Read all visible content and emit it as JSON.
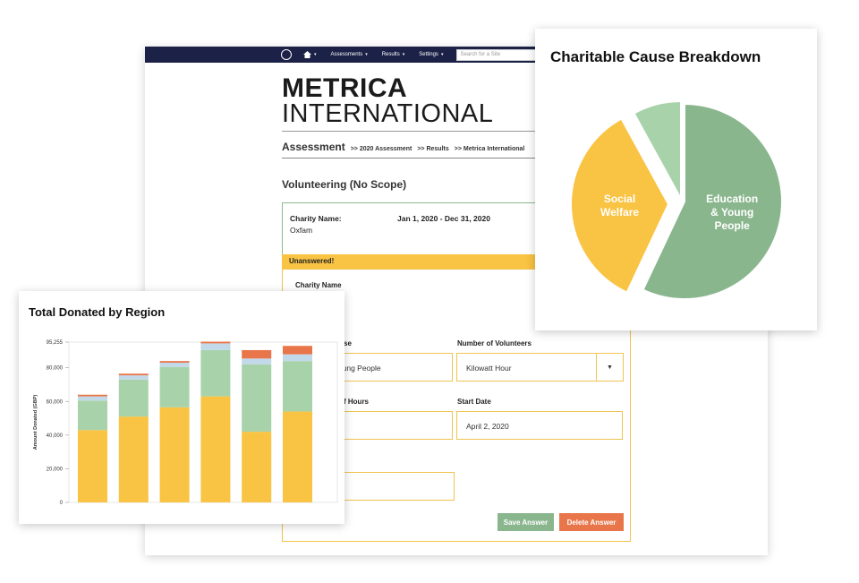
{
  "navbar": {
    "home_icon": "home-icon",
    "items": [
      {
        "label": "Assessments"
      },
      {
        "label": "Results"
      },
      {
        "label": "Settings"
      }
    ],
    "search_placeholder": "Search for a Site"
  },
  "brand": {
    "title": "METRICA",
    "subtitle": "INTERNATIONAL"
  },
  "breadcrumb": {
    "title": "Assessment",
    "items": [
      ">> 2020 Assessment",
      ">> Results",
      ">> Metrica International"
    ]
  },
  "section_title": "Volunteering (No Scope)",
  "info": {
    "charity_label": "Charity Name:",
    "charity_value": "Oxfam",
    "date_range": "Jan 1, 2020 - Dec 31, 2020"
  },
  "status_banner": "Unanswered!",
  "form": {
    "charity_name_label": "Charity Name",
    "cause_label_partial": "se",
    "cause_value_partial": "Young People",
    "volunteers_label": "Number of Volunteers",
    "volunteers_value": "Kilowatt Hour",
    "hours_label_partial": "f Hours",
    "start_date_label": "Start Date",
    "start_date_value": "April 2, 2020",
    "bottom_field_partial": ")",
    "save_label": "Save Answer",
    "delete_label": "Delete Answer"
  },
  "colors": {
    "navy": "#1b2147",
    "yellow": "#f9c343",
    "green_light": "#a8d3aa",
    "green_dark": "#8ab68e",
    "blue_light": "#c2d9ea",
    "orange": "#e8764a"
  },
  "chart_data": [
    {
      "type": "bar",
      "title": "Total Donated by Region",
      "ylabel": "Amount Donated (GBP)",
      "ylim": [
        0,
        95255
      ],
      "yticks": [
        "0",
        "20,000",
        "40,000",
        "60,000",
        "80,000",
        "95,255"
      ],
      "ytick_values": [
        0,
        20000,
        40000,
        60000,
        80000,
        95255
      ],
      "stacked": true,
      "categories": [
        "",
        "",
        "",
        "",
        "",
        ""
      ],
      "series": [
        {
          "color": "#f9c343",
          "values": [
            43000,
            51000,
            56500,
            63000,
            42000,
            54000
          ]
        },
        {
          "color": "#a8d3aa",
          "values": [
            17500,
            22000,
            24000,
            27500,
            40000,
            30000
          ]
        },
        {
          "color": "#c2d9ea",
          "values": [
            2500,
            2500,
            2500,
            4000,
            3500,
            4000
          ]
        },
        {
          "color": "#e8764a",
          "values": [
            1000,
            1000,
            1000,
            1000,
            5000,
            5000
          ]
        }
      ]
    },
    {
      "type": "pie",
      "title": "Charitable Cause Breakdown",
      "slices": [
        {
          "label": "Education & Young People",
          "value": 57,
          "color": "#8ab68e"
        },
        {
          "label": "Social Welfare",
          "value": 35,
          "color": "#f9c343"
        },
        {
          "label": "",
          "value": 8,
          "color": "#a8d3aa"
        }
      ]
    }
  ]
}
